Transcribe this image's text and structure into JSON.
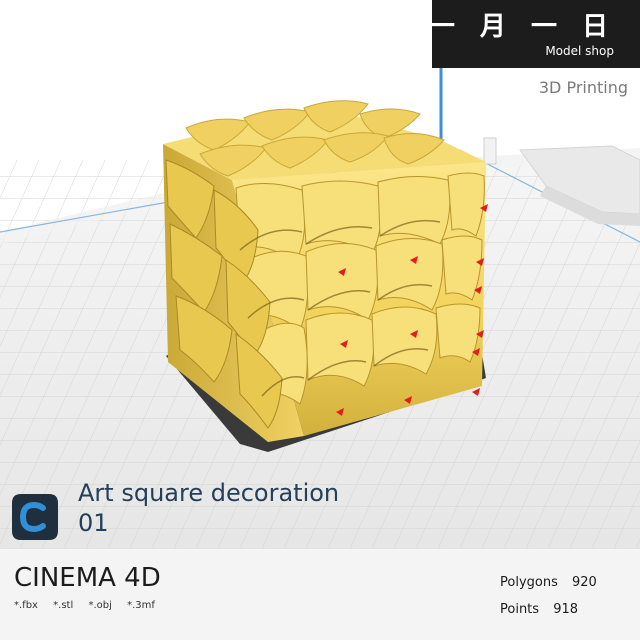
{
  "brand": {
    "title": "一 月 一 日",
    "subtitle": "Model shop"
  },
  "viewer": {
    "label": "3D Printing"
  },
  "project": {
    "title_line1": "Art square decoration",
    "title_line2": "01"
  },
  "software": {
    "name": "CINEMA 4D",
    "logo_icon": "cinema4d-logo-icon",
    "formats": [
      "*.fbx",
      "*.stl",
      "*.obj",
      "*.3mf"
    ]
  },
  "stats": {
    "polygons_label": "Polygons",
    "polygons_value": "920",
    "points_label": "Points",
    "points_value": "918"
  },
  "colors": {
    "model": "#f2d35d",
    "model_shadow": "#c9a836",
    "build_plate": "#ededed",
    "accent_red": "#e21d1d",
    "axis_blue": "#3f8ed8",
    "axis_green": "#36b24a",
    "brand_bg": "#1c1c1c",
    "title_color": "#243f57"
  }
}
